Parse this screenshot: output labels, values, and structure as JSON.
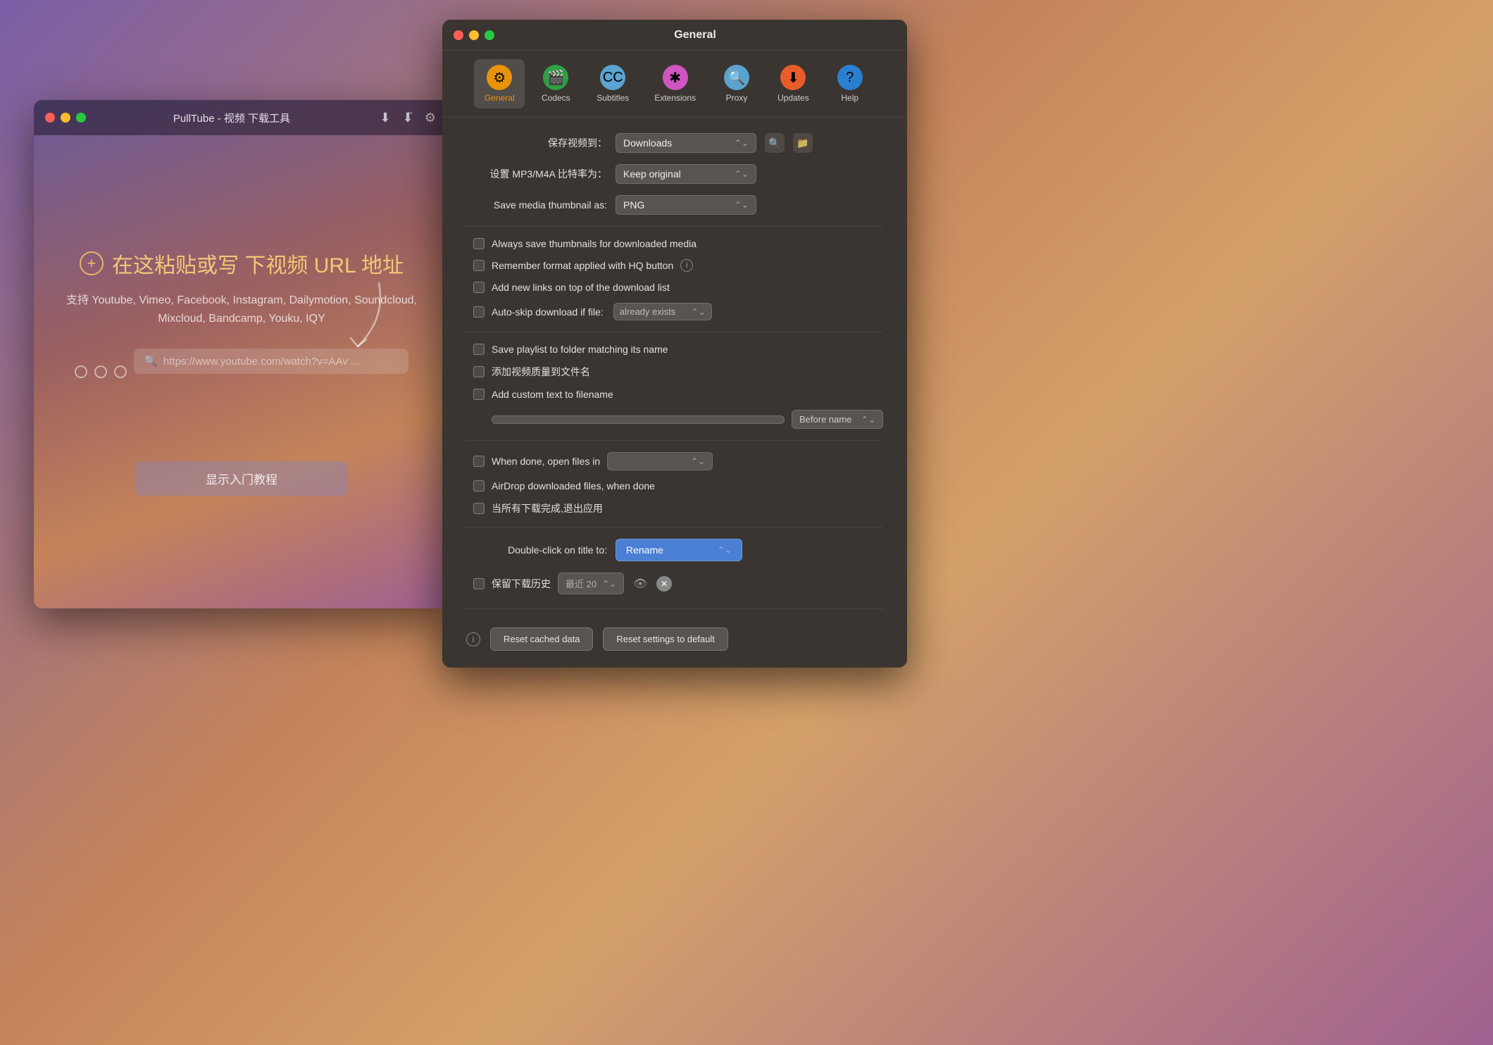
{
  "pulltube": {
    "title": "PullTube - 视频 下载工具",
    "traffic_lights": [
      "close",
      "minimize",
      "maximize"
    ],
    "main_hint": "在这粘贴或写 下视频 URL 地址",
    "sub_hint": "支持 Youtube, Vimeo, Facebook, Instagram, Dailymotion,\nSoundcloud, Mixcloud, Bandcamp, Youku, IQY",
    "search_placeholder": "https://www.youtube.com/watch?v=AAv ...",
    "tutorial_btn": "显示入门教程"
  },
  "settings": {
    "title": "General",
    "toolbar": {
      "items": [
        {
          "id": "general",
          "label": "General",
          "active": true
        },
        {
          "id": "codecs",
          "label": "Codecs",
          "active": false
        },
        {
          "id": "subtitles",
          "label": "Subtitles",
          "active": false
        },
        {
          "id": "extensions",
          "label": "Extensions",
          "active": false
        },
        {
          "id": "proxy",
          "label": "Proxy",
          "active": false
        },
        {
          "id": "updates",
          "label": "Updates",
          "active": false
        },
        {
          "id": "help",
          "label": "Help",
          "active": false
        }
      ]
    },
    "form": {
      "save_to_label": "保存视频到：",
      "save_to_value": "Downloads",
      "bitrate_label": "设置 MP3/M4A 比特率为：",
      "bitrate_value": "Keep original",
      "thumbnail_label": "Save media thumbnail as:",
      "thumbnail_value": "PNG",
      "checkboxes": [
        {
          "id": "always_save_thumbnails",
          "label": "Always save thumbnails for downloaded media",
          "checked": false
        },
        {
          "id": "remember_format",
          "label": "Remember format applied with HQ button",
          "checked": false,
          "has_info": true
        },
        {
          "id": "add_new_links_top",
          "label": "Add new links on top of the download list",
          "checked": false
        },
        {
          "id": "auto_skip",
          "label": "Auto-skip download if file:",
          "checked": false,
          "has_inline_select": true,
          "inline_select_value": "already exists"
        }
      ],
      "save_playlist_label": "Save playlist to folder matching its name",
      "add_quality_label": "添加视频质量到文件名",
      "add_custom_text_label": "Add custom text to filename",
      "custom_text_placeholder": "",
      "position_select_value": "Before name",
      "when_done_label": "When done, open files in",
      "airdrop_label": "AirDrop downloaded files, when done",
      "exit_label": "当所有下载完成,退出应用",
      "double_click_label": "Double-click on title to:",
      "rename_value": "Rename",
      "keep_history_label": "保留下载历史",
      "history_count": "最近 20",
      "reset_cached_label": "Reset cached data",
      "reset_settings_label": "Reset settings to default"
    }
  }
}
